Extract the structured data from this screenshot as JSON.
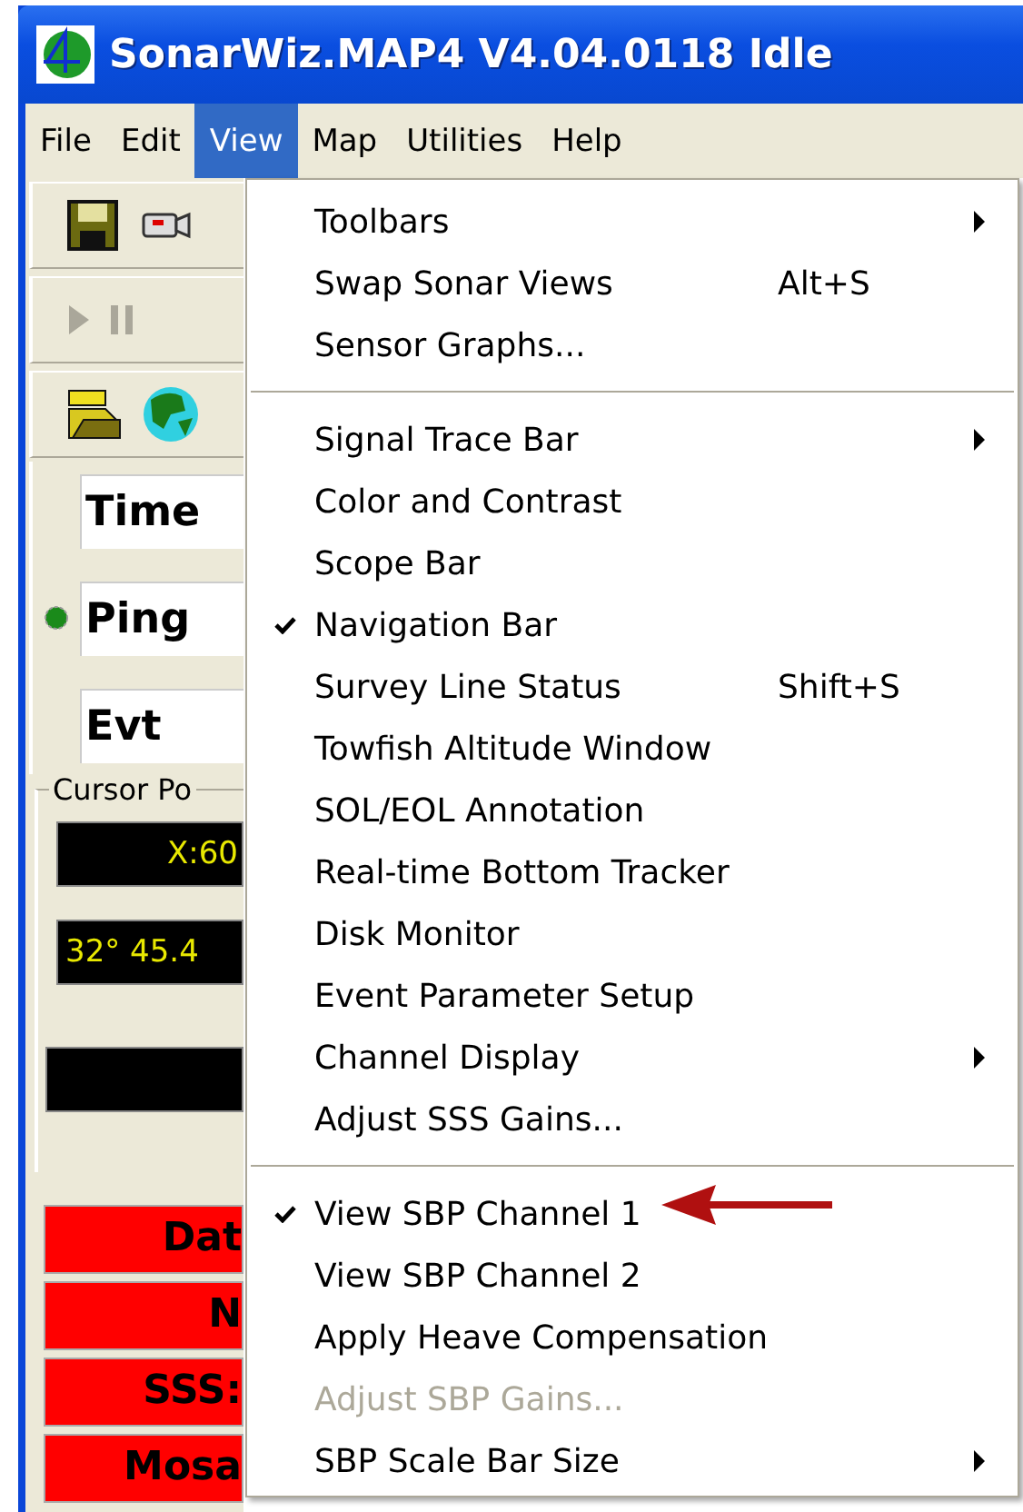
{
  "window": {
    "title": "SonarWiz.MAP4 V4.04.0118 Idle"
  },
  "menu_bar": [
    {
      "label": "File",
      "selected": false
    },
    {
      "label": "Edit",
      "selected": false
    },
    {
      "label": "View",
      "selected": true
    },
    {
      "label": "Map",
      "selected": false
    },
    {
      "label": "Utilities",
      "selected": false
    },
    {
      "label": "Help",
      "selected": false
    }
  ],
  "readouts": [
    "Time",
    "Ping",
    "Evt"
  ],
  "cursor_position": {
    "title": "Cursor Po",
    "values": [
      "X:60",
      "32° 45.4"
    ]
  },
  "status": [
    "Dat",
    "N",
    "SSS:",
    "Mosa"
  ],
  "view_menu": {
    "groups": [
      [
        {
          "label": "Toolbars",
          "checked": false,
          "disabled": false,
          "submenu": true
        },
        {
          "label": "Swap Sonar Views",
          "shortcut": "Alt+S",
          "checked": false,
          "disabled": false,
          "submenu": false
        },
        {
          "label": "Sensor Graphs...",
          "checked": false,
          "disabled": false,
          "submenu": false
        }
      ],
      [
        {
          "label": "Signal Trace Bar",
          "checked": false,
          "disabled": false,
          "submenu": true
        },
        {
          "label": "Color and Contrast",
          "checked": false,
          "disabled": false,
          "submenu": false
        },
        {
          "label": "Scope Bar",
          "checked": false,
          "disabled": false,
          "submenu": false
        },
        {
          "label": "Navigation Bar",
          "checked": true,
          "disabled": false,
          "submenu": false
        },
        {
          "label": "Survey Line Status",
          "shortcut": "Shift+S",
          "checked": false,
          "disabled": false,
          "submenu": false
        },
        {
          "label": "Towfish Altitude Window",
          "checked": false,
          "disabled": false,
          "submenu": false
        },
        {
          "label": "SOL/EOL Annotation",
          "checked": false,
          "disabled": false,
          "submenu": false
        },
        {
          "label": "Real-time Bottom Tracker",
          "checked": false,
          "disabled": false,
          "submenu": false
        },
        {
          "label": "Disk Monitor",
          "checked": false,
          "disabled": false,
          "submenu": false
        },
        {
          "label": "Event Parameter Setup",
          "checked": false,
          "disabled": false,
          "submenu": false
        },
        {
          "label": "Channel Display",
          "checked": false,
          "disabled": false,
          "submenu": true
        },
        {
          "label": "Adjust SSS Gains...",
          "checked": false,
          "disabled": false,
          "submenu": false
        }
      ],
      [
        {
          "label": "View SBP Channel 1",
          "checked": true,
          "disabled": false,
          "submenu": false
        },
        {
          "label": "View SBP Channel 2",
          "checked": false,
          "disabled": false,
          "submenu": false
        },
        {
          "label": "Apply Heave Compensation",
          "checked": false,
          "disabled": false,
          "submenu": false
        },
        {
          "label": "Adjust SBP Gains...",
          "checked": false,
          "disabled": true,
          "submenu": false
        },
        {
          "label": "SBP Scale Bar Size",
          "checked": false,
          "disabled": false,
          "submenu": true
        }
      ]
    ]
  }
}
